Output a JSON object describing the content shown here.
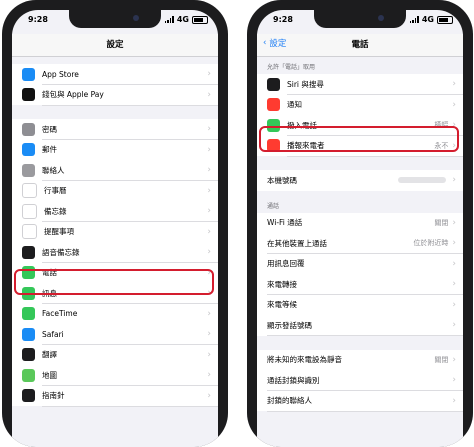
{
  "left": {
    "status_time": "9:28",
    "network": "4G",
    "nav_title": "設定",
    "group1": [
      {
        "label": "App Store",
        "icon": "app-store-icon",
        "color": "#1a8cf5"
      },
      {
        "label": "錢包與 Apple Pay",
        "icon": "wallet-icon",
        "color": "#111111"
      }
    ],
    "group2": [
      {
        "label": "密碼",
        "icon": "key-icon",
        "color": "#8e8e93"
      },
      {
        "label": "郵件",
        "icon": "mail-icon",
        "color": "#1a8cf5"
      },
      {
        "label": "聯絡人",
        "icon": "contacts-icon",
        "color": "#9a9a9e"
      },
      {
        "label": "行事曆",
        "icon": "calendar-icon",
        "color": "#ffffff"
      },
      {
        "label": "備忘錄",
        "icon": "notes-icon",
        "color": "#ffffff"
      },
      {
        "label": "提醒事項",
        "icon": "reminders-icon",
        "color": "#ffffff"
      },
      {
        "label": "語音備忘錄",
        "icon": "voice-memos-icon",
        "color": "#1c1c1e"
      },
      {
        "label": "電話",
        "icon": "phone-icon",
        "color": "#34c759"
      },
      {
        "label": "訊息",
        "icon": "messages-icon",
        "color": "#34c759"
      },
      {
        "label": "FaceTime",
        "icon": "facetime-icon",
        "color": "#34c759"
      },
      {
        "label": "Safari",
        "icon": "safari-icon",
        "color": "#1a8cf5"
      },
      {
        "label": "翻譯",
        "icon": "translate-icon",
        "color": "#1c1c1e"
      },
      {
        "label": "地圖",
        "icon": "maps-icon",
        "color": "#5ac85a"
      },
      {
        "label": "指南針",
        "icon": "compass-icon",
        "color": "#1c1c1e"
      }
    ]
  },
  "right": {
    "status_time": "9:28",
    "network": "4G",
    "back_label": "設定",
    "nav_title": "電話",
    "section_allow": "允許「電話」取用",
    "allow_rows": [
      {
        "label": "Siri 與搜尋",
        "icon": "siri-icon",
        "color": "#1c1c1e",
        "value": ""
      },
      {
        "label": "通知",
        "icon": "notifications-icon",
        "color": "#ff3b30",
        "value": ""
      },
      {
        "label": "撥入電話",
        "icon": "incoming-call-icon",
        "color": "#34c759",
        "value": "橫幅"
      },
      {
        "label": "播報來電者",
        "icon": "announce-calls-icon",
        "color": "#ff3b30",
        "value": "永不"
      }
    ],
    "my_number_label": "本機號碼",
    "section_calls": "通話",
    "call_rows": [
      {
        "label": "Wi-Fi 通話",
        "value": "關閉"
      },
      {
        "label": "在其他裝置上通話",
        "value": "位於附近時"
      },
      {
        "label": "用訊息回覆",
        "value": ""
      },
      {
        "label": "來電轉接",
        "value": ""
      },
      {
        "label": "來電等候",
        "value": ""
      },
      {
        "label": "顯示發話號碼",
        "value": ""
      }
    ],
    "bottom_rows": [
      {
        "label": "將未知的來電設為靜音",
        "value": "關閉"
      },
      {
        "label": "通話封鎖與識別",
        "value": ""
      },
      {
        "label": "封鎖的聯絡人",
        "value": ""
      }
    ]
  },
  "highlight_color": "#d41d2e"
}
